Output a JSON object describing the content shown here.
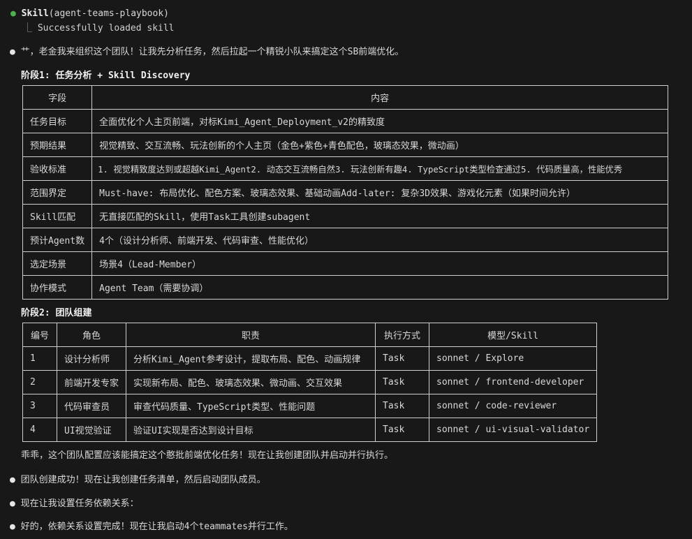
{
  "skill_call": {
    "name": "Skill",
    "arg": "(agent-teams-playbook)",
    "result": "Successfully loaded skill"
  },
  "intro": "艹，老金我来组织这个团队！让我先分析任务，然后拉起一个精锐小队来搞定这个SB前端优化。",
  "phase1": {
    "title": "阶段1: 任务分析 + Skill Discovery",
    "headers": [
      "字段",
      "内容"
    ],
    "rows": [
      [
        "任务目标",
        "全面优化个人主页前端，对标Kimi_Agent_Deployment_v2的精致度"
      ],
      [
        "预期结果",
        "视觉精致、交互流畅、玩法创新的个人主页（金色+紫色+青色配色，玻璃态效果，微动画）"
      ],
      [
        "验收标准",
        "1. 视觉精致度达到或超越Kimi_Agent2. 动态交互流畅自然3. 玩法创新有趣4. TypeScript类型检查通过5. 代码质量高，性能优秀"
      ],
      [
        "范围界定",
        "Must-have: 布局优化、配色方案、玻璃态效果、基础动画Add-later: 复杂3D效果、游戏化元素（如果时间允许）"
      ],
      [
        "Skill匹配",
        "无直接匹配的Skill，使用Task工具创建subagent"
      ],
      [
        "预计Agent数",
        "4个（设计分析师、前端开发、代码审查、性能优化）"
      ],
      [
        "选定场景",
        "场景4（Lead-Member）"
      ],
      [
        "协作模式",
        "Agent Team（需要协调）"
      ]
    ]
  },
  "phase2": {
    "title": "阶段2: 团队组建",
    "headers": [
      "编号",
      "角色",
      "职责",
      "执行方式",
      "模型/Skill"
    ],
    "rows": [
      [
        "1",
        "设计分析师",
        "分析Kimi_Agent参考设计，提取布局、配色、动画规律",
        "Task",
        "sonnet / Explore"
      ],
      [
        "2",
        "前端开发专家",
        "实现新布局、配色、玻璃态效果、微动画、交互效果",
        "Task",
        "sonnet / frontend-developer"
      ],
      [
        "3",
        "代码审查员",
        "审查代码质量、TypeScript类型、性能问题",
        "Task",
        "sonnet / code-reviewer"
      ],
      [
        "4",
        "UI视觉验证",
        "验证UI实现是否达到设计目标",
        "Task",
        "sonnet / ui-visual-validator"
      ]
    ]
  },
  "after_table": "乖乖，这个团队配置应该能搞定这个憨批前端优化任务！现在让我创建团队并启动并行执行。",
  "messages": [
    "团队创建成功！现在让我创建任务清单，然后启动团队成员。",
    "现在让我设置任务依赖关系：",
    "好的，依赖关系设置完成！现在让我启动4个teammates并行工作。"
  ],
  "colors": {
    "background": "#181818",
    "bullet_green": "#4caf50",
    "border": "#cfcfcf"
  }
}
